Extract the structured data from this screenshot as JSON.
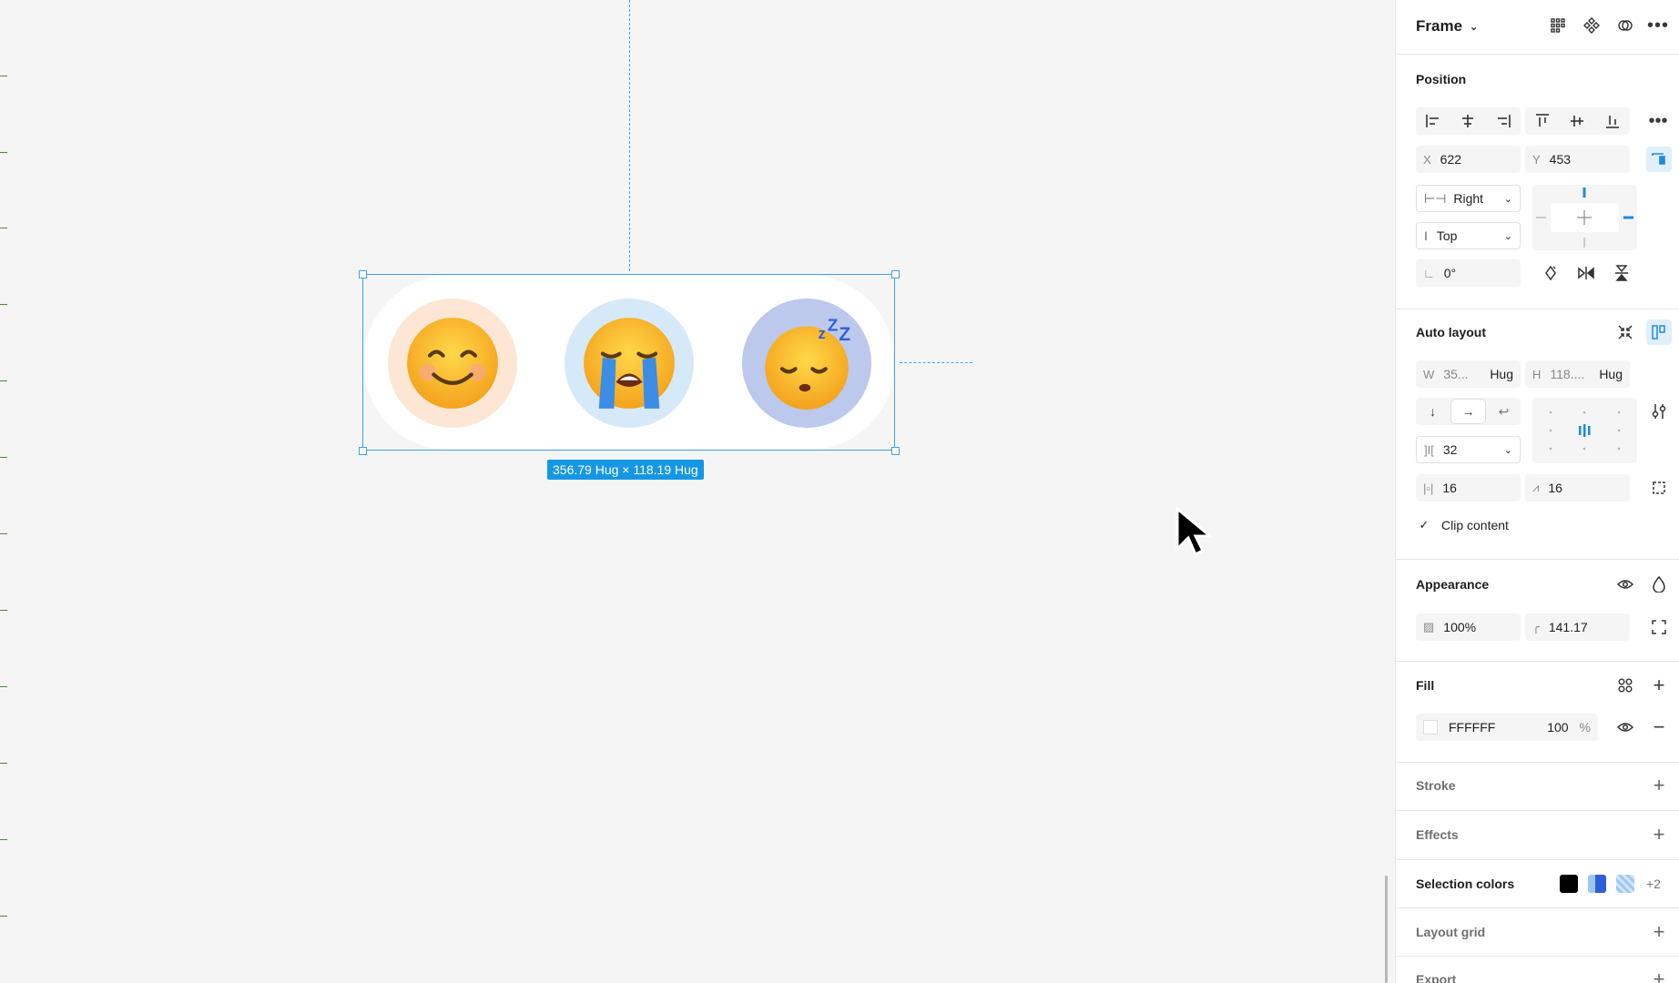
{
  "canvas": {
    "size_label": "356.79 Hug × 118.19 Hug",
    "emojis": [
      {
        "name": "smiling-face",
        "bg": "#fde6d3"
      },
      {
        "name": "crying-face",
        "bg": "#d6e9f8"
      },
      {
        "name": "sleeping-face",
        "bg": "#bcc8ec"
      }
    ]
  },
  "panel": {
    "header": {
      "title": "Frame"
    },
    "position": {
      "title": "Position",
      "x_label": "X",
      "x": "622",
      "y_label": "Y",
      "y": "453",
      "h_constraint": "Right",
      "v_constraint": "Top",
      "rotation": "0°"
    },
    "auto_layout": {
      "title": "Auto layout",
      "w_label": "W",
      "w": "35...",
      "w_mode": "Hug",
      "h_label": "H",
      "h": "118....",
      "h_mode": "Hug",
      "gap": "32",
      "padding_h": "16",
      "padding_v": "16",
      "clip_label": "Clip content"
    },
    "appearance": {
      "title": "Appearance",
      "opacity": "100%",
      "radius": "141.17"
    },
    "fill": {
      "title": "Fill",
      "hex": "FFFFFF",
      "opacity": "100",
      "pct": "%"
    },
    "stroke": {
      "title": "Stroke"
    },
    "effects": {
      "title": "Effects"
    },
    "selection_colors": {
      "title": "Selection colors",
      "more": "+2",
      "colors": [
        "#000000",
        "#2f5fd8",
        "#9cc8f0"
      ]
    },
    "layout_grid": {
      "title": "Layout grid"
    },
    "export": {
      "title": "Export"
    }
  }
}
